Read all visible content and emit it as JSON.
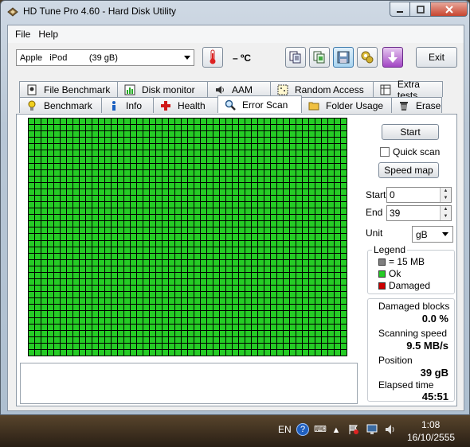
{
  "window": {
    "title": "HD Tune Pro 4.60 - Hard Disk Utility"
  },
  "menu": {
    "file": "File",
    "help": "Help"
  },
  "toolbar": {
    "drive": "Apple   iPod         (39 gB)",
    "temperature": "– ºC",
    "exit_label": "Exit"
  },
  "tabs_top": [
    "File Benchmark",
    "Disk monitor",
    "AAM",
    "Random Access",
    "Extra tests"
  ],
  "tabs_bottom": [
    "Benchmark",
    "Info",
    "Health",
    "Error Scan",
    "Folder Usage",
    "Erase"
  ],
  "active_tab": "Error Scan",
  "error_scan": {
    "start_button": "Start",
    "quick_scan_label": "Quick scan",
    "quick_scan_checked": false,
    "speed_map_button": "Speed map",
    "start_label": "Start",
    "start_value": "0",
    "end_label": "End",
    "end_value": "39",
    "unit_label": "Unit",
    "unit_value": "gB",
    "legend": {
      "title": "Legend",
      "items": [
        {
          "label": "= 15 MB",
          "color": "#808080"
        },
        {
          "label": "Ok",
          "color": "#25cc25"
        },
        {
          "label": "Damaged",
          "color": "#cc0000"
        }
      ]
    },
    "stats": {
      "damaged_blocks_label": "Damaged blocks",
      "damaged_blocks_value": "0.0 %",
      "scanning_speed_label": "Scanning speed",
      "scanning_speed_value": "9.5 MB/s",
      "position_label": "Position",
      "position_value": "39 gB",
      "elapsed_label": "Elapsed time",
      "elapsed_value": "45:51"
    },
    "block_color": "#25cc25"
  },
  "taskbar": {
    "language": "EN",
    "time": "1:08",
    "date": "16/10/2555"
  }
}
